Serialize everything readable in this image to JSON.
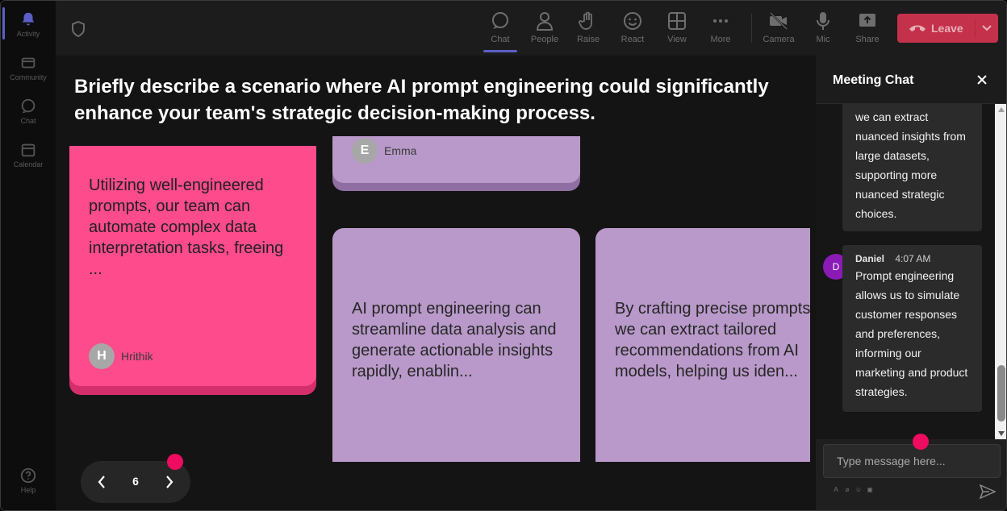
{
  "rail": {
    "items": [
      {
        "label": "Activity",
        "icon": "bell-icon"
      },
      {
        "label": "Community",
        "icon": "community-icon"
      },
      {
        "label": "Chat",
        "icon": "chat-icon"
      },
      {
        "label": "Calendar",
        "icon": "calendar-icon"
      }
    ],
    "help": "Help"
  },
  "toolbar": {
    "chat": "Chat",
    "people": "People",
    "raise": "Raise",
    "react": "React",
    "view": "View",
    "more": "More",
    "camera": "Camera",
    "mic": "Mic",
    "share": "Share",
    "leave": "Leave"
  },
  "board": {
    "question": "Briefly describe a scenario where AI prompt engineering could significantly enhance your team's strategic decision-making process.",
    "cards": [
      {
        "text": "Utilizing well-engineered prompts, our team can automate complex data interpretation tasks, freeing ...",
        "author": "Hrithik",
        "initial": "H",
        "color": "#fd4b8c"
      },
      {
        "author": "Emma",
        "initial": "E",
        "color": "#b899c9"
      },
      {
        "text": "AI prompt engineering can streamline data analysis and generate actionable insights rapidly, enablin...",
        "color": "#b899c9"
      },
      {
        "text": "By crafting precise prompts, we can extract tailored recommendations from AI models, helping us iden...",
        "color": "#b899c9"
      }
    ],
    "pager": {
      "page": "6"
    }
  },
  "chat": {
    "title": "Meeting Chat",
    "messages": [
      {
        "text": "we can extract nuanced insights from large datasets, supporting more nuanced strategic choices."
      },
      {
        "author": "Daniel",
        "initial": "D",
        "time": "4:07 AM",
        "text": "Prompt engineering allows us to simulate customer responses and preferences, informing our marketing and product strategies."
      }
    ],
    "input_placeholder": "Type message here..."
  },
  "colors": {
    "accent": "#5b5fc7",
    "leave": "#c4314b",
    "pink_card": "#fd4b8c",
    "purple_card": "#b899c9",
    "dot": "#ef0b5f",
    "chat_avatar": "#8a1bb5"
  }
}
